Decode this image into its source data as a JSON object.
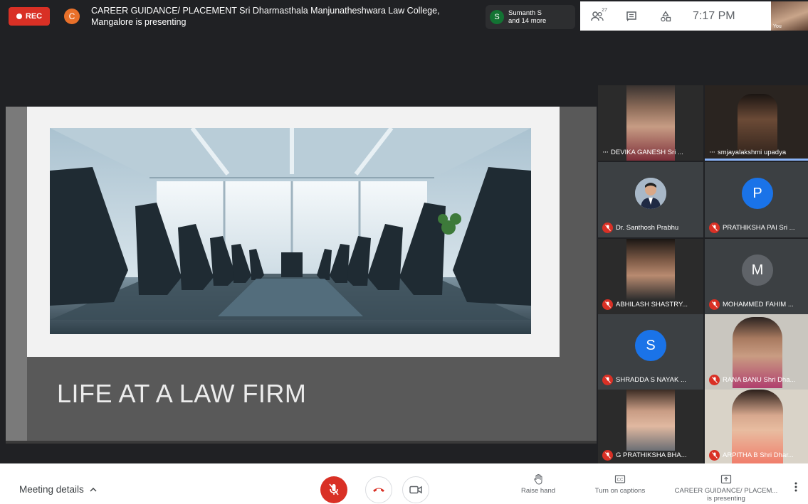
{
  "top_bar": {
    "rec_label": "REC",
    "presenter_initial": "C",
    "meeting_title": "CAREER GUIDANCE/ PLACEMENT Sri Dharmasthala Manjunatheshwara Law College, Mangalore is presenting",
    "active_speaker": {
      "initial": "S",
      "name": "Sumanth S",
      "more": "and 14 more"
    },
    "participant_count": "27",
    "time": "7:17 PM",
    "self_label": "You"
  },
  "presentation": {
    "slide_title": "LIFE AT A LAW FIRM"
  },
  "participants": [
    {
      "name": "DEVIKA GANESH Sri ...",
      "type": "video",
      "muted": false,
      "menu": "···"
    },
    {
      "name": "smjayalakshmi upadya",
      "type": "video",
      "muted": false,
      "menu": "···",
      "speaking": true
    },
    {
      "name": "Dr. Santhosh Prabhu",
      "type": "avatar-photo",
      "muted": true
    },
    {
      "name": "PRATHIKSHA PAI Sri ...",
      "type": "letter",
      "letter": "P",
      "color": "#1a73e8",
      "muted": true
    },
    {
      "name": "ABHILASH SHASTRY...",
      "type": "video",
      "muted": true
    },
    {
      "name": "MOHAMMED FAHIM ...",
      "type": "letter",
      "letter": "M",
      "color": "#5f6368",
      "muted": true
    },
    {
      "name": "SHRADDA S NAYAK ...",
      "type": "letter",
      "letter": "S",
      "color": "#1a73e8",
      "muted": true
    },
    {
      "name": "RANA BANU Shri Dha...",
      "type": "video",
      "muted": true
    },
    {
      "name": "G PRATHIKSHA BHA...",
      "type": "video",
      "muted": true
    },
    {
      "name": "ARPITHA B Shri Dhar...",
      "type": "video",
      "muted": true
    }
  ],
  "bottom_bar": {
    "meeting_details": "Meeting details",
    "raise_hand": "Raise hand",
    "captions": "Turn on captions",
    "presenting_line1": "CAREER GUIDANCE/ PLACEM...",
    "presenting_line2": "is presenting"
  }
}
